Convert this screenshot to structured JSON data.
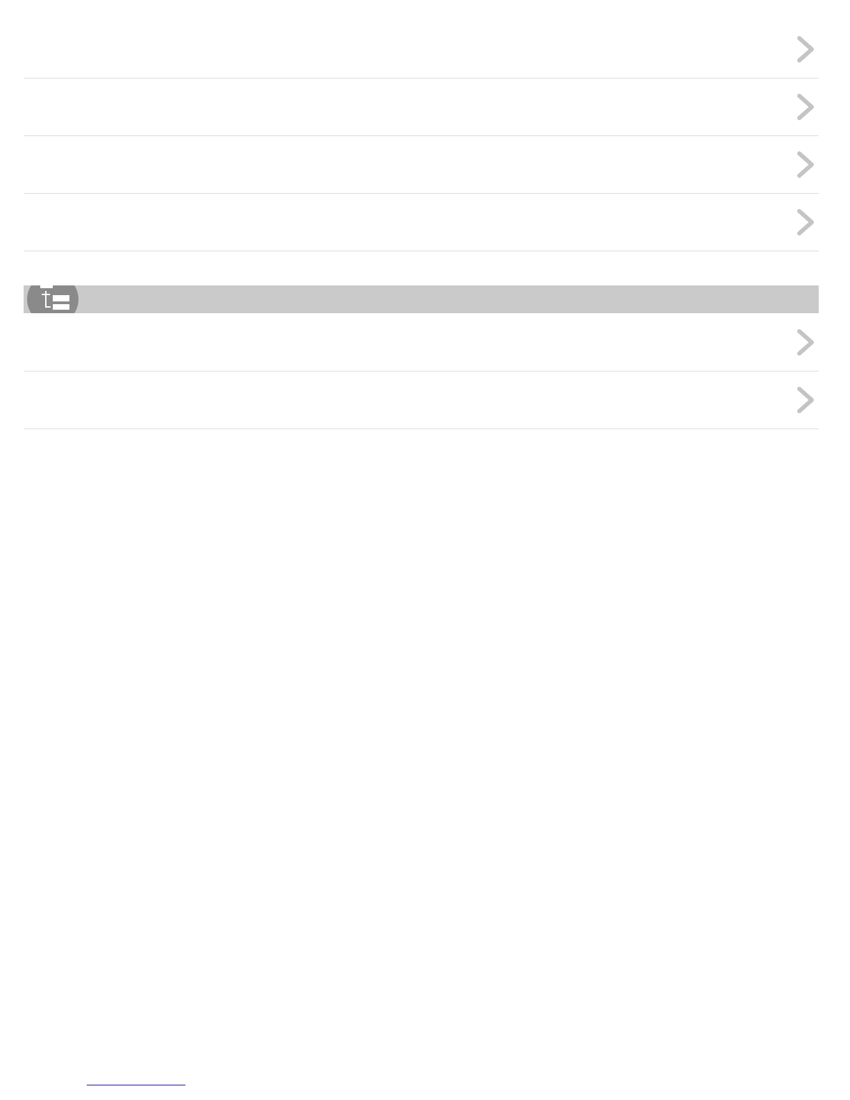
{
  "list_top": {
    "items": [
      {
        "label": ""
      },
      {
        "label": ""
      },
      {
        "label": ""
      },
      {
        "label": ""
      }
    ]
  },
  "section": {
    "title": "",
    "icon": "toc-list-icon",
    "header_color": "#cacaca"
  },
  "list_bottom": {
    "items": [
      {
        "label": ""
      },
      {
        "label": ""
      }
    ]
  },
  "footer": {
    "link_text": ""
  },
  "colors": {
    "divider": "#dcdcdc",
    "chevron": "#c4c4c4",
    "icon_circle": "#8a8a8a",
    "link": "#1a0dab"
  }
}
